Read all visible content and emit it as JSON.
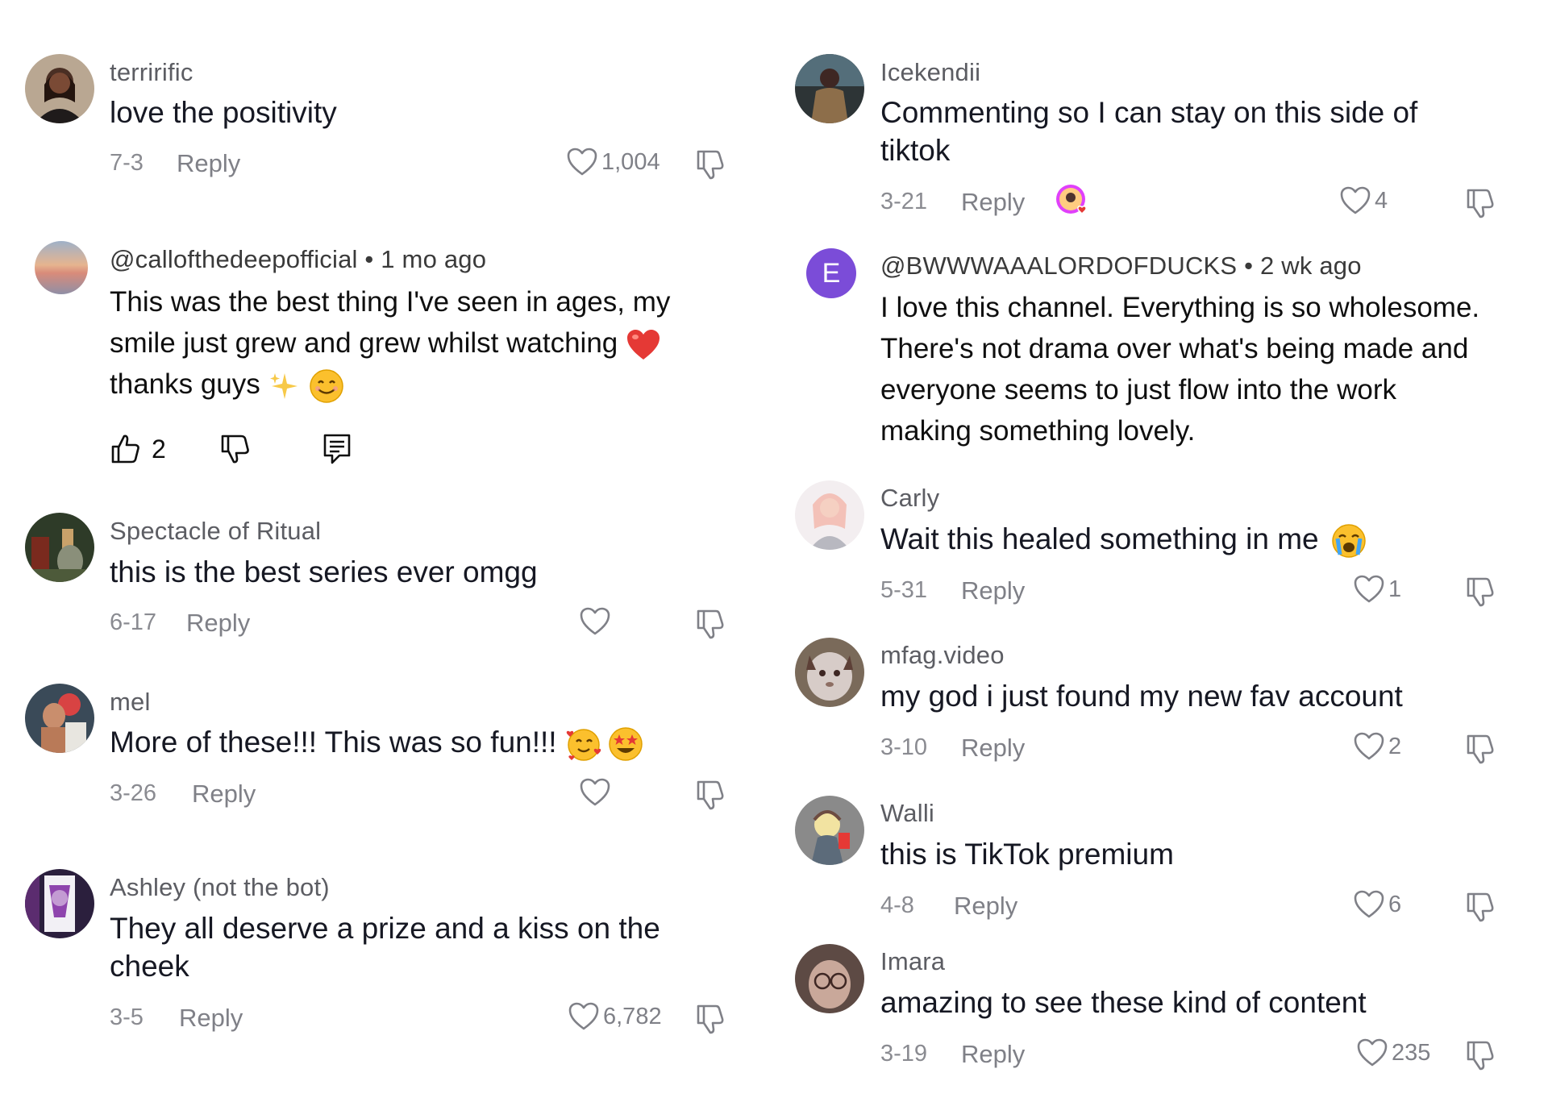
{
  "left_comments": [
    {
      "username": "terrirific",
      "text": [
        "love the positivity"
      ],
      "date": "7-3",
      "reply": "Reply",
      "likes": "1,004"
    },
    {
      "username": "@callofthedeepofficial",
      "meta": " • 1 mo ago",
      "text": [
        "This was the best thing I've seen in ages, my",
        "smile just grew and grew whilst watching",
        "thanks guys"
      ],
      "likes": "2"
    },
    {
      "username": "Spectacle of Ritual",
      "text": [
        "this is the best series ever omgg"
      ],
      "date": "6-17",
      "reply": "Reply",
      "likes": ""
    },
    {
      "username": "mel",
      "text": [
        "More of these!!! This was so fun!!!"
      ],
      "date": "3-26",
      "reply": "Reply",
      "likes": ""
    },
    {
      "username": "Ashley (not the bot)",
      "text": [
        "They all deserve a prize and a kiss on the",
        "cheek"
      ],
      "date": "3-5",
      "reply": "Reply",
      "likes": "6,782"
    }
  ],
  "right_comments": [
    {
      "username": "Icekendii",
      "text": [
        "Commenting so I can stay on this side of",
        "tiktok"
      ],
      "date": "3-21",
      "reply": "Reply",
      "likes": "4"
    },
    {
      "username": "@BWWWAAALORDOFDUCKS",
      "meta": " • 2 wk ago",
      "avatar_letter": "E",
      "text": [
        "I love this channel. Everything is so wholesome.",
        "There's not drama over what's being made and",
        "everyone seems to just flow into the work",
        "making something lovely."
      ]
    },
    {
      "username": "Carly",
      "text": [
        "Wait this healed something in me"
      ],
      "date": "5-31",
      "reply": "Reply",
      "likes": "1"
    },
    {
      "username": "mfag.video",
      "text": [
        "my god i just found my new fav account"
      ],
      "date": "3-10",
      "reply": "Reply",
      "likes": "2"
    },
    {
      "username": "Walli",
      "text": [
        "this is TikTok premium"
      ],
      "date": "4-8",
      "reply": "Reply",
      "likes": "6"
    },
    {
      "username": "Imara",
      "text": [
        "amazing to see these kind of content"
      ],
      "date": "3-19",
      "reply": "Reply",
      "likes": "235"
    }
  ],
  "colors": {
    "text": "#161823",
    "muted": "#8a8b91",
    "avatar_letter_bg": "#7b4cd8",
    "heart_red": "#e53935"
  }
}
